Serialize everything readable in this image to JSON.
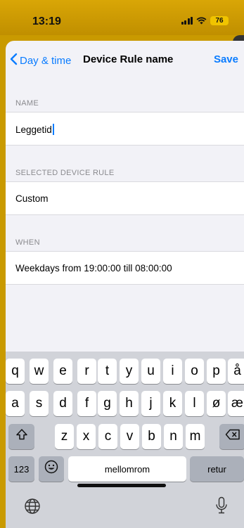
{
  "status": {
    "time": "13:19",
    "battery": "76"
  },
  "nav": {
    "back_label": "Day & time",
    "title": "Device Rule name",
    "save_label": "Save"
  },
  "sections": [
    {
      "header": "NAME",
      "value": "Leggetid"
    },
    {
      "header": "SELECTED DEVICE RULE",
      "value": "Custom"
    },
    {
      "header": "WHEN",
      "value": "Weekdays from 19:00:00 till 08:00:00"
    }
  ],
  "keyboard": {
    "row1": [
      "q",
      "w",
      "e",
      "r",
      "t",
      "y",
      "u",
      "i",
      "o",
      "p",
      "å"
    ],
    "row2": [
      "a",
      "s",
      "d",
      "f",
      "g",
      "h",
      "j",
      "k",
      "l",
      "ø",
      "æ"
    ],
    "row3": [
      "z",
      "x",
      "c",
      "v",
      "b",
      "n",
      "m"
    ],
    "numbers_label": "123",
    "space_label": "mellomrom",
    "return_label": "retur",
    "icons": {
      "shift": "shift-icon",
      "delete": "delete-icon",
      "emoji": "emoji-icon",
      "globe": "globe-icon",
      "mic": "microphone-icon"
    }
  },
  "colors": {
    "accent": "#0a7cff",
    "status_bar": "#c99a00",
    "keyboard_bg": "#d1d3d9"
  }
}
